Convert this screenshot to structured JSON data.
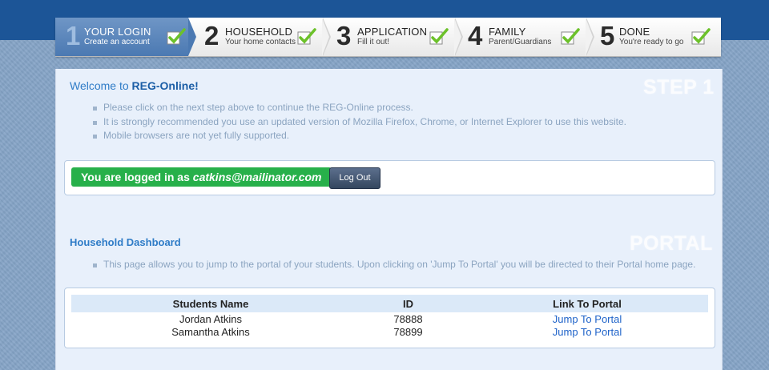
{
  "steps": [
    {
      "num": "1",
      "name": "YOUR LOGIN",
      "sub": "Create an account",
      "active": true
    },
    {
      "num": "2",
      "name": "HOUSEHOLD",
      "sub": "Your home contacts"
    },
    {
      "num": "3",
      "name": "APPLICATION",
      "sub": "Fill it out!"
    },
    {
      "num": "4",
      "name": "FAMILY",
      "sub": "Parent/Guardians"
    },
    {
      "num": "5",
      "name": "DONE",
      "sub": "You're ready to go"
    }
  ],
  "welcome": {
    "prefix": "Welcome to ",
    "brand": "REG-Online!"
  },
  "step_watermark": "STEP 1",
  "instructions": [
    "Please click on the next step above to continue the REG-Online process.",
    "It is strongly recommended you use an updated version of Mozilla Firefox, Chrome, or Internet Explorer to use this website.",
    "Mobile browsers are not yet fully supported."
  ],
  "login": {
    "prefix": "You are logged in as ",
    "email": "catkins@mailinator.com",
    "logout_label": "Log Out"
  },
  "dashboard": {
    "title": "Household Dashboard",
    "watermark": "PORTAL",
    "note": "This page allows you to jump to the portal of your students. Upon clicking on 'Jump To Portal' you will be directed to their Portal home page."
  },
  "table": {
    "headers": [
      "Students Name",
      "ID",
      "Link To Portal"
    ],
    "rows": [
      {
        "name": "Jordan Atkins",
        "id": "78888",
        "link": "Jump To Portal"
      },
      {
        "name": "Samantha Atkins",
        "id": "78899",
        "link": "Jump To Portal"
      }
    ]
  },
  "colors": {
    "accent": "#1c5597",
    "check": "#6cc12a",
    "logged_in": "#27b04a"
  },
  "icons": {
    "check": "checkmark-icon"
  }
}
